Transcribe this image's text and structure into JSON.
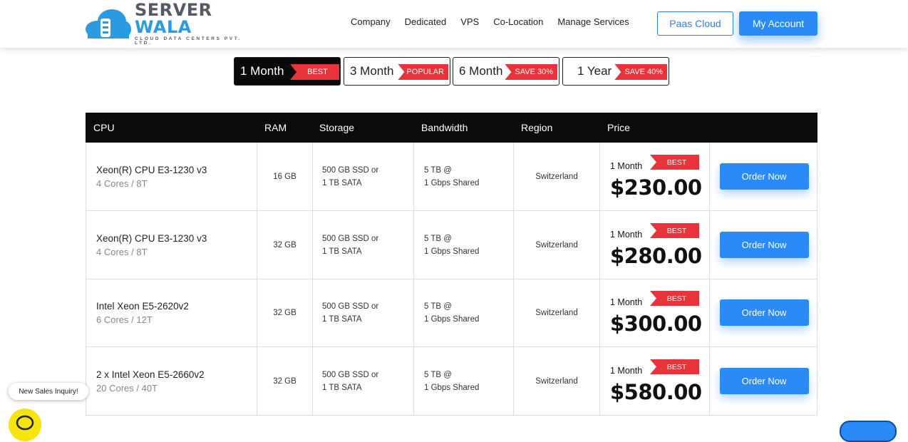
{
  "brand": {
    "name_part1": "SERVER",
    "name_part2": "WALA",
    "tagline": "CLOUD DATA CENTERS PVT. LTD."
  },
  "nav": {
    "items": [
      "Company",
      "Dedicated",
      "VPS",
      "Co-Location",
      "Manage Services"
    ]
  },
  "buttons": {
    "paas": "Paas Cloud",
    "account": "My Account"
  },
  "tabs": [
    {
      "label": "1 Month",
      "badge": "BEST",
      "active": true
    },
    {
      "label": "3 Month",
      "badge": "POPULAR",
      "active": false
    },
    {
      "label": "6 Month",
      "badge": "SAVE 30%",
      "active": false
    },
    {
      "label": "1 Year",
      "badge": "SAVE 40%",
      "active": false
    }
  ],
  "table": {
    "headers": [
      "CPU",
      "RAM",
      "Storage",
      "Bandwidth",
      "Region",
      "Price"
    ],
    "rows": [
      {
        "cpu": "Xeon(R) CPU E3-1230 v3",
        "cores": "4 Cores / 8T",
        "ram": "16 GB",
        "storage1": "500 GB SSD or",
        "storage2": "1 TB SATA",
        "bw1": "5 TB @",
        "bw2": "1 Gbps Shared",
        "region": "Switzerland",
        "period": "1 Month",
        "badge": "BEST",
        "price": "$230.00",
        "action": "Order Now"
      },
      {
        "cpu": "Xeon(R) CPU E3-1230 v3",
        "cores": "4 Cores / 8T",
        "ram": "32 GB",
        "storage1": "500 GB SSD or",
        "storage2": "1 TB SATA",
        "bw1": "5 TB @",
        "bw2": "1 Gbps Shared",
        "region": "Switzerland",
        "period": "1 Month",
        "badge": "BEST",
        "price": "$280.00",
        "action": "Order Now"
      },
      {
        "cpu": "Intel Xeon E5-2620v2",
        "cores": "6 Cores / 12T",
        "ram": "32 GB",
        "storage1": "500 GB SSD or",
        "storage2": "1 TB SATA",
        "bw1": "5 TB @",
        "bw2": "1 Gbps Shared",
        "region": "Switzerland",
        "period": "1 Month",
        "badge": "BEST",
        "price": "$300.00",
        "action": "Order Now"
      },
      {
        "cpu": "2 x Intel Xeon E5-2660v2",
        "cores": "20 Cores / 40T",
        "ram": "32 GB",
        "storage1": "500 GB SSD or",
        "storage2": "1 TB SATA",
        "bw1": "5 TB @",
        "bw2": "1 Gbps Shared",
        "region": "Switzerland",
        "period": "1 Month",
        "badge": "BEST",
        "price": "$580.00",
        "action": "Order Now"
      }
    ]
  },
  "floating": {
    "sales_inquiry": "New Sales Inquiry!"
  },
  "colors": {
    "accent": "#2b8bf6",
    "badge": "#e8333b",
    "chat": "#f7e40e"
  }
}
